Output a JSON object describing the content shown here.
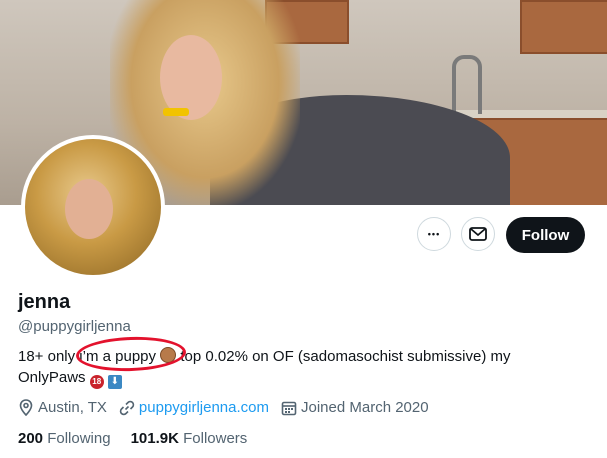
{
  "profile": {
    "name": "jenna",
    "handle": "@puppygirljenna",
    "bio_part1": "18+ only ",
    "bio_highlight": "i’m a puppy",
    "bio_part2": " top 0.02% on OF (sadomasochist submissive) my OnlyPaws ",
    "eighteen_badge": "18",
    "down_badge": "⬇",
    "location": "Austin, TX",
    "website": "puppygirljenna.com",
    "joined": "Joined March 2020"
  },
  "stats": {
    "following_count": "200",
    "following_label": "Following",
    "followers_count": "101.9K",
    "followers_label": "Followers"
  },
  "actions": {
    "more_label": "•••",
    "follow_label": "Follow"
  },
  "colors": {
    "accent_link": "#1d9bf0",
    "follow_bg": "#0f1419",
    "annotation_red": "#e3122d"
  },
  "icons": [
    "more-icon",
    "mail-icon",
    "location-icon",
    "link-icon",
    "calendar-icon"
  ]
}
